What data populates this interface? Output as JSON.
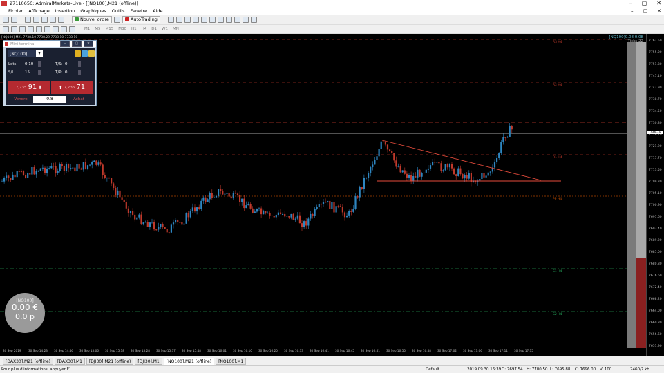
{
  "window": {
    "title": "27110656: AdmiralMarkets-Live - [[NQ100],M21 (offline)]",
    "controls": [
      "–",
      "▢",
      "✕"
    ]
  },
  "menu": {
    "items": [
      "Fichier",
      "Affichage",
      "Insertion",
      "Graphiques",
      "Outils",
      "Fenetre",
      "Aide"
    ],
    "right_controls": [
      "–",
      "▢",
      "✕"
    ]
  },
  "toolbar": {
    "new_order": "Nouvel ordre",
    "autotrading": "AutoTrading",
    "timeframes": [
      "M1",
      "M5",
      "M15",
      "M30",
      "H1",
      "H4",
      "D1",
      "W1",
      "MN"
    ]
  },
  "chart": {
    "header": "[NQ100],M21  7738.10 7738.29 7738.10 7738.10",
    "ticks_label": "[NQ100]0.08 0.08",
    "ticks_sub": "Ticks   22",
    "y_labels": [
      "7762.50",
      "7755.00",
      "7751.30",
      "7747.10",
      "7742.90",
      "7738.70",
      "7734.50",
      "7730.30",
      "7726.10",
      "7721.90",
      "7717.70",
      "7713.50",
      "7709.30",
      "7705.10",
      "7700.90",
      "7697.60",
      "7693.40",
      "7689.20",
      "7685.00",
      "7680.80",
      "7676.60",
      "7672.40",
      "7668.20",
      "7664.00",
      "7660.80",
      "7656.60",
      "7651.90"
    ],
    "current_price": "7736.10",
    "x_labels": [
      "30 Sep 2019",
      "30 Sep 14:23",
      "30 Sep 14:46",
      "30 Sep 15:06",
      "30 Sep 15:18",
      "30 Sep 15:28",
      "30 Sep 15:37",
      "30 Sep 15:48",
      "30 Sep 16:01",
      "30 Sep 16:10",
      "30 Sep 16:20",
      "30 Sep 16:33",
      "30 Sep 16:41",
      "30 Sep 16:45",
      "30 Sep 16:51",
      "30 Sep 16:55",
      "30 Sep 16:58",
      "30 Sep 17:02",
      "30 Sep 17:06",
      "30 Sep 17:11",
      "30 Sep 17:15"
    ],
    "pivots": [
      "R3 H4",
      "R2 H4",
      "R1 H4",
      "PP H4",
      "S1 H4",
      "S2 H4"
    ]
  },
  "mini_terminal": {
    "title": "Mini terminal",
    "symbol": "[NQ100]",
    "lots_label": "Lots:",
    "lots_value": "0.10",
    "sl_label": "S/L:",
    "sl_value": "15",
    "ts_label": "T/S:",
    "ts_value": "0",
    "tp_label": "T/P:",
    "tp_value": "0",
    "sell_small": "7,735",
    "sell_big": "91",
    "buy_small": "7,736",
    "buy_big": "71",
    "sell_label": "Vendre",
    "volume": "0.8",
    "buy_label": "Achat"
  },
  "pnl": {
    "symbol": "[NQ100]",
    "value": "0.00 €",
    "points": "0.0 p"
  },
  "tabs": [
    "[DAX30],M21 (offline)",
    "[DAX30],M1",
    "[DJI30],M21 (offline)",
    "[DJI30],M1",
    "[NQ100],M21 (offline)",
    "[NQ100],M1"
  ],
  "active_tab": 4,
  "status": {
    "help": "Pour plus d'informations, appuyer F1",
    "profile": "Default",
    "datetime": "2019.09.30 16:39",
    "open": "O: 7697.54",
    "high": "H: 7700.50",
    "low": "L: 7695.88",
    "close": "C: 7696.00",
    "volume": "V: 100",
    "traffic": "2460/7 kb"
  },
  "colors": {
    "bull": "#2e86c1",
    "bear": "#c0392b",
    "pivot_res": "#c0392b",
    "pivot_pp": "#d35400",
    "pivot_sup": "#27ae60",
    "trend": "#e74c3c"
  }
}
